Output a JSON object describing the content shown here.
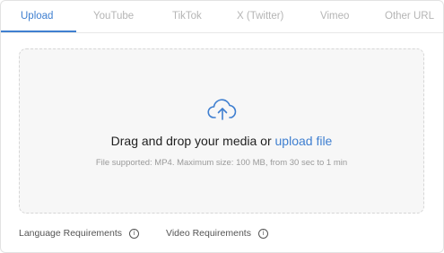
{
  "tabs": [
    {
      "label": "Upload",
      "active": true
    },
    {
      "label": "YouTube",
      "active": false
    },
    {
      "label": "TikTok",
      "active": false
    },
    {
      "label": "X (Twitter)",
      "active": false
    },
    {
      "label": "Vimeo",
      "active": false
    },
    {
      "label": "Other URL",
      "active": false
    }
  ],
  "dropzone": {
    "icon": "cloud-upload-icon",
    "headline_prefix": "Drag and drop your media or ",
    "headline_link": "upload file",
    "subline": "File supported: MP4. Maximum size: 100 MB, from 30 sec to 1 min"
  },
  "requirements": {
    "language_label": "Language Requirements",
    "video_label": "Video Requirements",
    "info_glyph": "i"
  },
  "colors": {
    "accent": "#3f7fd0",
    "inactive_tab": "#b5b5b5",
    "dropzone_bg": "#f7f7f7"
  }
}
